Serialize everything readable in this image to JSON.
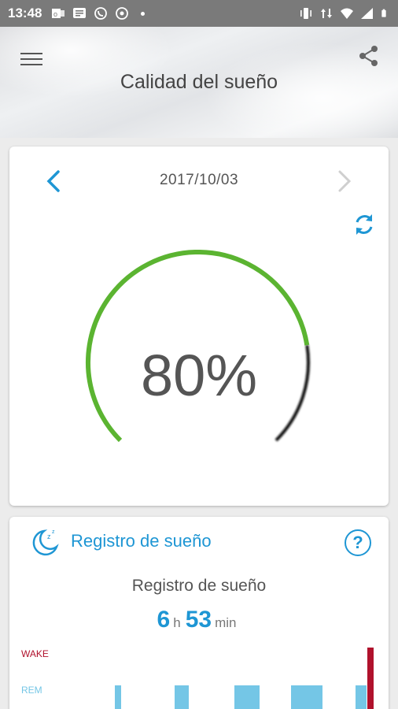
{
  "status_bar": {
    "time": "13:48",
    "left_icons": [
      "outlook-icon",
      "messages-icon",
      "whatsapp-icon",
      "chat-icon"
    ],
    "right_icons": [
      "vibrate-icon",
      "data-arrows-icon",
      "wifi-icon",
      "signal-icon",
      "battery-icon"
    ]
  },
  "header": {
    "title": "Calidad del sueño"
  },
  "score_card": {
    "date": "2017/10/03",
    "score_text": "80%",
    "score_fraction": 0.8,
    "colors": {
      "progress": "#5bb431",
      "remaining": "#111111",
      "accent": "#1e96d4"
    }
  },
  "record_card": {
    "header_label": "Registro de sueño",
    "help_label": "?",
    "subtitle": "Registro de sueño",
    "hours": "6",
    "hours_unit": "h",
    "minutes": "53",
    "minutes_unit": "min",
    "stage_labels": {
      "wake": "WAKE",
      "rem": "REM"
    },
    "colors": {
      "wake": "#b0112c",
      "rem": "#74c6e6"
    }
  }
}
